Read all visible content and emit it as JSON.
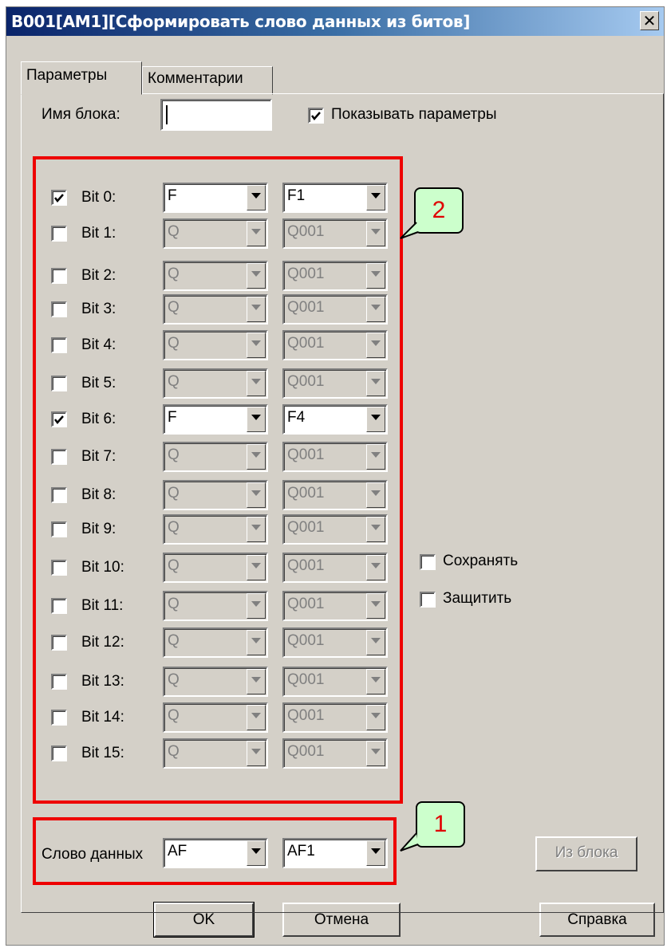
{
  "window": {
    "title": "B001[AM1][Сформировать слово данных из битов]",
    "close_glyph": "✕"
  },
  "tabs": [
    {
      "label": "Параметры",
      "active": true
    },
    {
      "label": "Комментарии",
      "active": false
    }
  ],
  "block_name": {
    "label": "Имя блока:",
    "value": ""
  },
  "show_params": {
    "label": "Показывать параметры",
    "checked": true
  },
  "bits": [
    {
      "label": "Bit 0:",
      "checked": true,
      "type": "F",
      "ref": "F1",
      "enabled": true
    },
    {
      "label": "Bit 1:",
      "checked": false,
      "type": "Q",
      "ref": "Q001",
      "enabled": false
    },
    {
      "label": "Bit 2:",
      "checked": false,
      "type": "Q",
      "ref": "Q001",
      "enabled": false
    },
    {
      "label": "Bit 3:",
      "checked": false,
      "type": "Q",
      "ref": "Q001",
      "enabled": false
    },
    {
      "label": "Bit 4:",
      "checked": false,
      "type": "Q",
      "ref": "Q001",
      "enabled": false
    },
    {
      "label": "Bit 5:",
      "checked": false,
      "type": "Q",
      "ref": "Q001",
      "enabled": false
    },
    {
      "label": "Bit 6:",
      "checked": true,
      "type": "F",
      "ref": "F4",
      "enabled": true
    },
    {
      "label": "Bit 7:",
      "checked": false,
      "type": "Q",
      "ref": "Q001",
      "enabled": false
    },
    {
      "label": "Bit 8:",
      "checked": false,
      "type": "Q",
      "ref": "Q001",
      "enabled": false
    },
    {
      "label": "Bit 9:",
      "checked": false,
      "type": "Q",
      "ref": "Q001",
      "enabled": false
    },
    {
      "label": "Bit 10:",
      "checked": false,
      "type": "Q",
      "ref": "Q001",
      "enabled": false
    },
    {
      "label": "Bit 11:",
      "checked": false,
      "type": "Q",
      "ref": "Q001",
      "enabled": false
    },
    {
      "label": "Bit 12:",
      "checked": false,
      "type": "Q",
      "ref": "Q001",
      "enabled": false
    },
    {
      "label": "Bit 13:",
      "checked": false,
      "type": "Q",
      "ref": "Q001",
      "enabled": false
    },
    {
      "label": "Bit 14:",
      "checked": false,
      "type": "Q",
      "ref": "Q001",
      "enabled": false
    },
    {
      "label": "Bit 15:",
      "checked": false,
      "type": "Q",
      "ref": "Q001",
      "enabled": false
    }
  ],
  "retain": {
    "label": "Сохранять",
    "checked": false
  },
  "protect": {
    "label": "Защитить",
    "checked": false
  },
  "data_word": {
    "label": "Слово данных",
    "type": "AF",
    "ref": "AF1"
  },
  "from_block_button": "Из блока",
  "callouts": {
    "bits_group": "2",
    "data_word": "1"
  },
  "buttons": {
    "ok": "OK",
    "cancel": "Отмена",
    "help": "Справка"
  },
  "colors": {
    "annotation_red": "#ee0000",
    "callout_fill": "#ccffcc",
    "title_start": "#0a246a",
    "face": "#d4d0c8"
  }
}
